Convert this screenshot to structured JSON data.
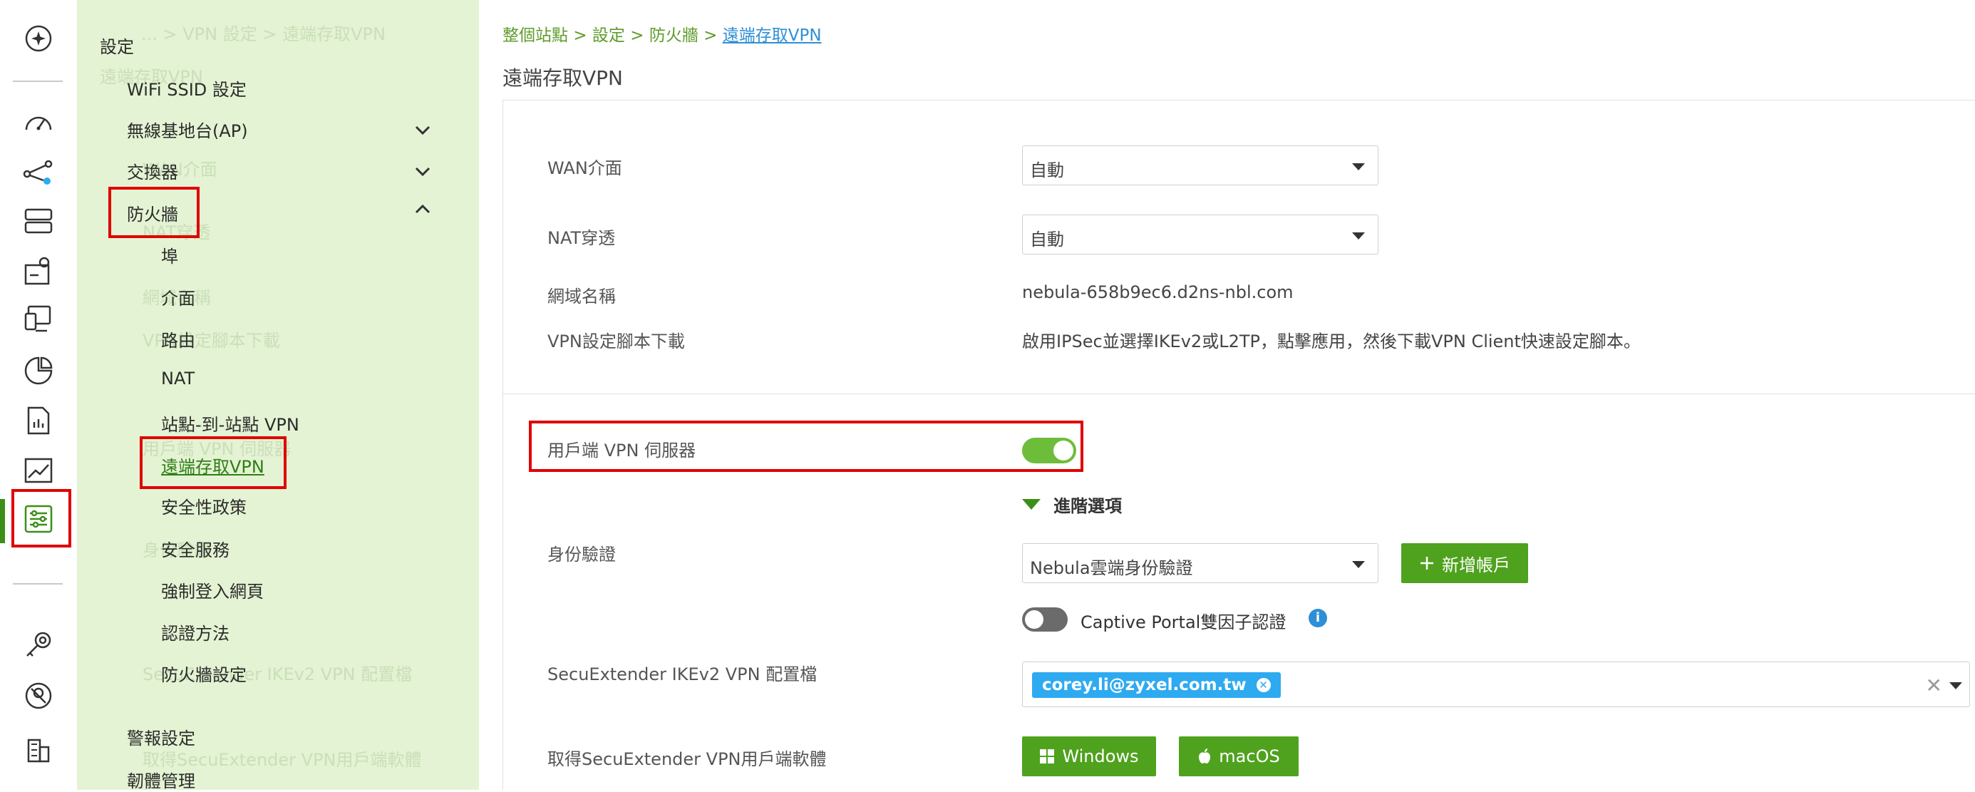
{
  "breadcrumb": {
    "part1": "整個站點",
    "sep1": ">",
    "part2": "設定",
    "sep2": ">",
    "part3": "防火牆",
    "sep3": ">",
    "current": "遠端存取VPN"
  },
  "page_title": "遠端存取VPN",
  "menu": {
    "ghost_text": {
      "g1": "... > VPN 設定 > 遠端存取VPN",
      "g2": "遠端存取VPN",
      "g3": "WAN介面",
      "g4": "NAT穿透",
      "g5": "網域名稱",
      "g6": "VPN設定腳本下載",
      "g7": "用戶端 VPN 伺服器",
      "g8": "身份驗證",
      "g9": "SecuExtender IKEv2 VPN 配置檔",
      "g10": "取得SecuExtender VPN用戶端軟體"
    },
    "heading": "設定",
    "items": {
      "wifi": "WiFi SSID 設定",
      "ap": "無線基地台(AP)",
      "switch": "交換器",
      "firewall": "防火牆",
      "alerts": "警報設定",
      "firmware": "韌體管理"
    },
    "firewall_sub": {
      "port": "埠",
      "interface": "介面",
      "routing": "路由",
      "nat": "NAT",
      "site_vpn": "站點-到-站點 VPN",
      "remote_vpn": "遠端存取VPN",
      "policy": "安全性政策",
      "services": "安全服務",
      "captive": "強制登入網頁",
      "auth": "認證方法",
      "fw_settings": "防火牆設定"
    }
  },
  "form": {
    "wan": {
      "label": "WAN介面",
      "value": "自動"
    },
    "nat": {
      "label": "NAT穿透",
      "value": "自動"
    },
    "domain": {
      "label": "網域名稱",
      "value": "nebula-658b9ec6.d2ns-nbl.com"
    },
    "script": {
      "label": "VPN設定腳本下載",
      "value": "啟用IPSec並選擇IKEv2或L2TP，點擊應用，然後下載VPN Client快速設定腳本。"
    },
    "server": {
      "label": "用戶端 VPN 伺服器",
      "enabled": true
    },
    "advanced": "進階選項",
    "auth": {
      "label": "身份驗證",
      "value": "Nebula雲端身份驗證",
      "add_button": "新增帳戶"
    },
    "captive_2fa": {
      "label": "Captive Portal雙因子認證",
      "enabled": false
    },
    "ikev2_profile": {
      "label": "SecuExtender IKEv2 VPN 配置檔",
      "tag": "corey.li@zyxel.com.tw"
    },
    "client_software": {
      "label": "取得SecuExtender VPN用戶端軟體",
      "windows": "Windows",
      "macos": "macOS"
    }
  },
  "colors": {
    "accent_green": "#4fa21d",
    "toggle_on": "#6dbd3b",
    "highlight_red": "#e00000",
    "tag_blue": "#2eaaf0",
    "menu_bg": "#e4f3d3"
  },
  "rail_icons": [
    "ai-assistant-icon",
    "dashboard-icon",
    "topology-icon",
    "devices-icon",
    "map-icon",
    "clients-icon",
    "reports-icon",
    "documents-icon",
    "monitor-icon",
    "settings-icon",
    "license-icon",
    "help-icon",
    "organization-icon"
  ]
}
